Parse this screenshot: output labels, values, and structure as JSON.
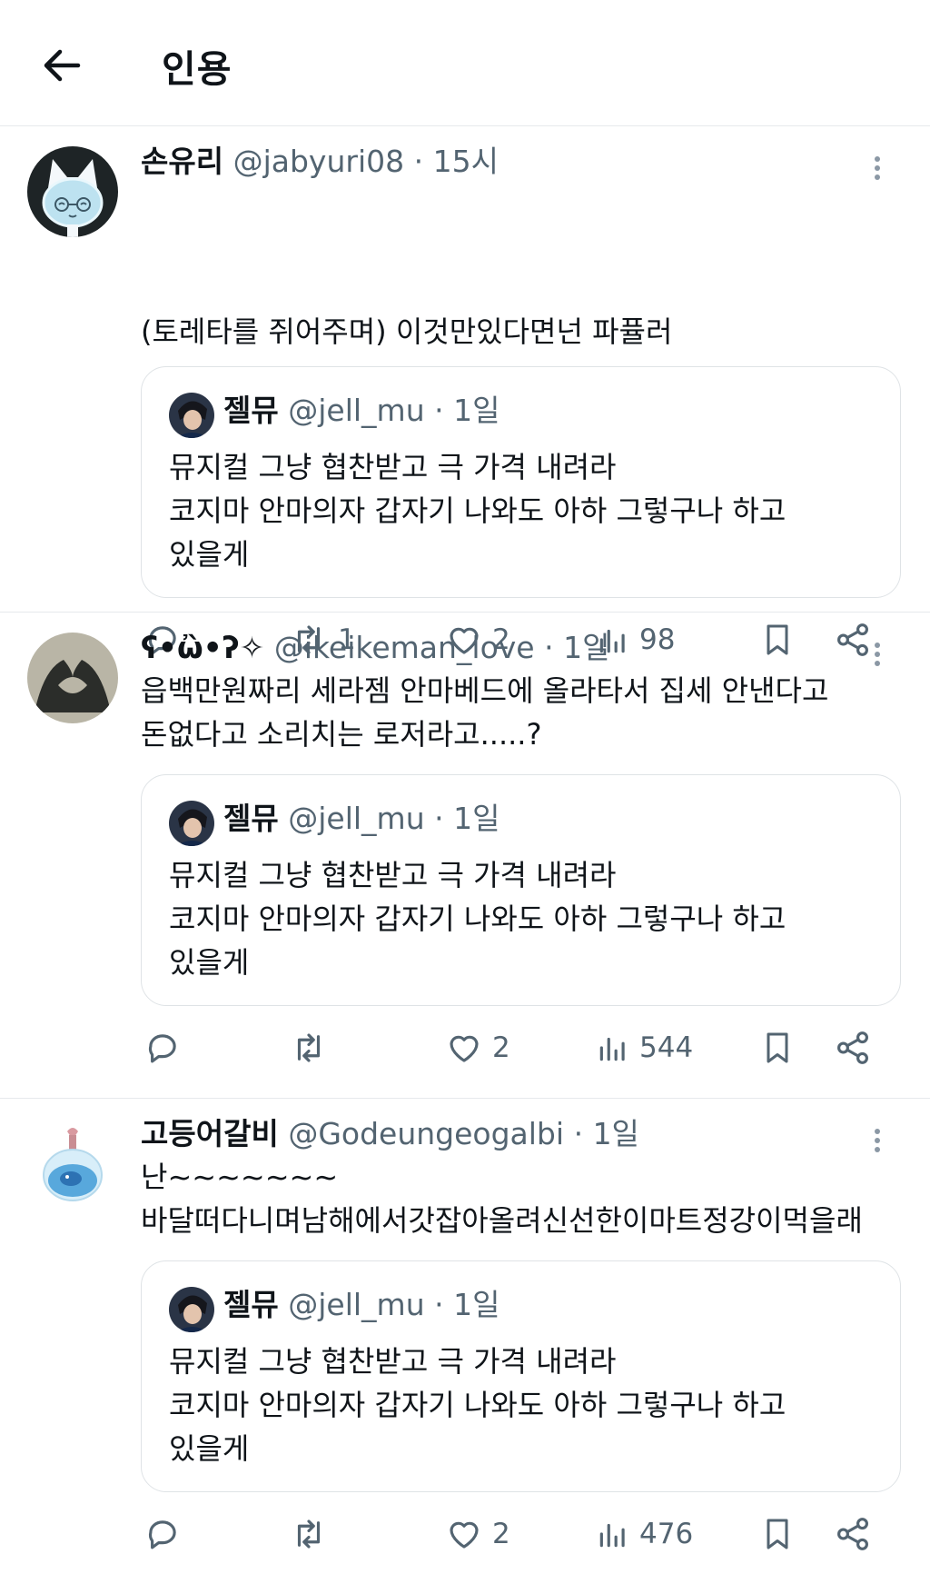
{
  "header": {
    "title": "인용"
  },
  "tweets": [
    {
      "name": "손유리",
      "handle": "@jabyuri08",
      "time": "15시",
      "text": "(토레타를 쥐어주며) 이것만있다면넌 파퓰러",
      "quote": {
        "name": "젤뮤",
        "handle": "@jell_mu",
        "time": "1일",
        "text": "뮤지컬 그냥 협찬받고 극 가격 내려라\n코지마 안마의자 갑자기 나와도 아하 그렇구나 하고\n있을게"
      },
      "retweets": "1",
      "likes": "2",
      "views": "98"
    },
    {
      "name": "ʕ•ὢ•ʔ✧",
      "handle": "@ikeikeman_love",
      "time": "1일",
      "text": "읍백만원짜리 세라젬 안마베드에 올라타서 집세 안낸다고\n돈없다고 소리치는 로저라고.....?",
      "quote": {
        "name": "젤뮤",
        "handle": "@jell_mu",
        "time": "1일",
        "text": "뮤지컬 그냥 협찬받고 극 가격 내려라\n코지마 안마의자 갑자기 나와도 아하 그렇구나 하고\n있을게"
      },
      "retweets": "",
      "likes": "2",
      "views": "544"
    },
    {
      "name": "고등어갈비",
      "handle": "@Godeungeogalbi",
      "time": "1일",
      "text": "난~~~~~~~\n바달떠다니며남해에서갓잡아올려신선한이마트정강이먹을래",
      "quote": {
        "name": "젤뮤",
        "handle": "@jell_mu",
        "time": "1일",
        "text": "뮤지컬 그냥 협찬받고 극 가격 내려라\n코지마 안마의자 갑자기 나와도 아하 그렇구나 하고\n있을게"
      },
      "retweets": "",
      "likes": "2",
      "views": "476"
    }
  ],
  "colors": {
    "text": "#0f1419",
    "muted": "#536471",
    "border": "#dfe3e6"
  },
  "icons": [
    "arrow-left-icon",
    "more-icon",
    "reply-icon",
    "retweet-icon",
    "heart-icon",
    "views-icon",
    "bookmark-icon",
    "share-icon"
  ]
}
